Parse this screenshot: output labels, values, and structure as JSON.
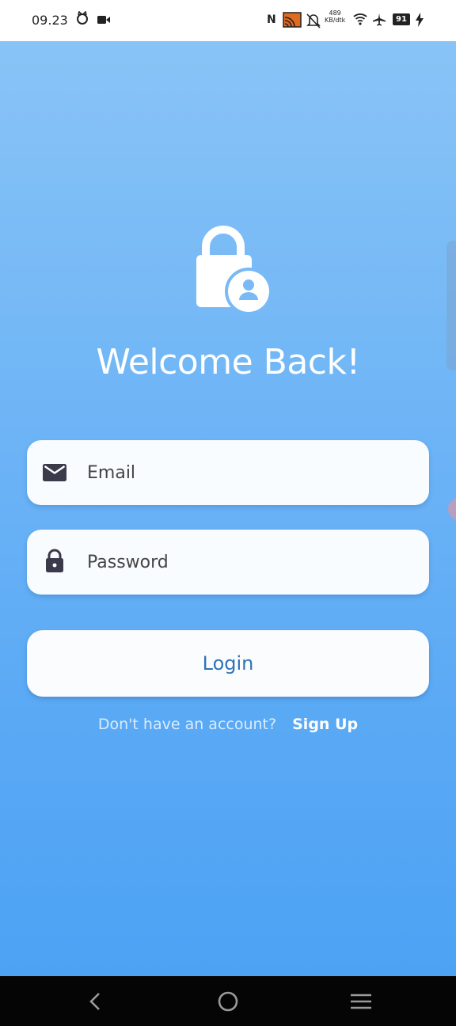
{
  "status_bar": {
    "time": "09.23",
    "net_speed_value": "489",
    "net_speed_unit": "KB/dtk",
    "battery": "91",
    "icons": [
      "cat-icon",
      "video-icon",
      "nfc-icon",
      "cast-icon",
      "bell-off-icon",
      "wifi-icon",
      "airplane-icon",
      "battery-icon",
      "charging-icon"
    ]
  },
  "login": {
    "title": "Welcome Back!",
    "email_placeholder": "Email",
    "password_placeholder": "Password",
    "login_label": "Login",
    "signup_prompt": "Don't have an account?",
    "signup_label": "Sign Up"
  },
  "colors": {
    "gradient_top": "#8cc5f7",
    "gradient_bottom": "#4aa1f4",
    "login_text": "#2c74b8",
    "field_icon": "#3a3a4a"
  },
  "nav_bar": {
    "icons": [
      "back-icon",
      "home-icon",
      "menu-icon"
    ]
  }
}
